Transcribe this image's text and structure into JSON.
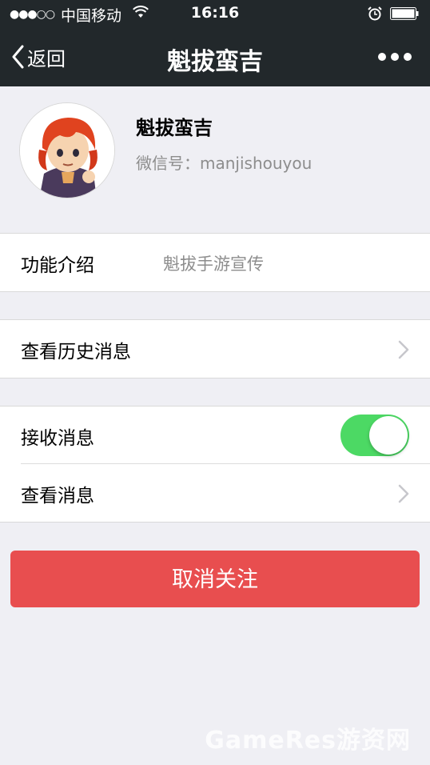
{
  "status_bar": {
    "signal": "●●●○○",
    "carrier": "中国移动",
    "time": "16:16"
  },
  "nav": {
    "back_label": "返回",
    "title": "魁拔蛮吉"
  },
  "profile": {
    "name": "魁拔蛮吉",
    "wechat_id": "微信号：manjishouyou"
  },
  "intro": {
    "label": "功能介绍",
    "value": "魁拔手游宣传"
  },
  "history": {
    "label": "查看历史消息"
  },
  "receive": {
    "label": "接收消息",
    "enabled": true
  },
  "view": {
    "label": "查看消息"
  },
  "unfollow_label": "取消关注",
  "watermark": "GameRes游资网",
  "colors": {
    "nav_bg": "#22282b",
    "page_bg": "#efeff4",
    "toggle_on": "#4cd964",
    "danger": "#e84e4f"
  }
}
